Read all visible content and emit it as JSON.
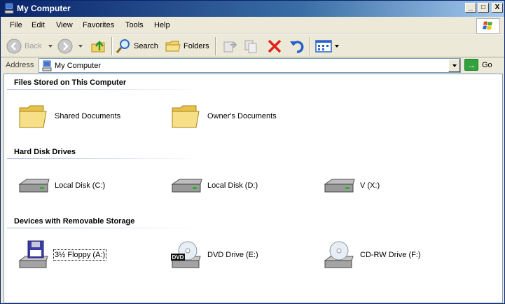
{
  "window": {
    "title": "My Computer",
    "caption_buttons": {
      "minimize": "_",
      "maximize": "□",
      "close": "X"
    }
  },
  "menu": [
    "File",
    "Edit",
    "View",
    "Favorites",
    "Tools",
    "Help"
  ],
  "toolbar": {
    "back_label": "Back",
    "search_label": "Search",
    "folders_label": "Folders"
  },
  "address": {
    "label": "Address",
    "value": "My Computer",
    "go_label": "Go"
  },
  "groups": {
    "files": {
      "title": "Files Stored on This Computer",
      "items": [
        "Shared Documents",
        "Owner's Documents"
      ]
    },
    "hdd": {
      "title": "Hard Disk Drives",
      "items": [
        "Local Disk (C:)",
        "Local Disk (D:)",
        "V (X:)"
      ]
    },
    "removable": {
      "title": "Devices with Removable Storage",
      "items": [
        "3½ Floppy (A:)",
        "DVD Drive (E:)",
        "CD-RW Drive (F:)"
      ]
    }
  },
  "icons": {
    "folder": "folder-icon",
    "hdd": "hard-disk-icon",
    "floppy": "floppy-drive-icon",
    "dvd": "dvd-drive-icon",
    "cd": "cd-drive-icon"
  },
  "dvd_badge": "DVD",
  "colors": {
    "title_gradient_start": "#0a246a",
    "title_gradient_end": "#a6caf0",
    "chrome": "#ece9d8",
    "go_green": "#31a23c"
  }
}
